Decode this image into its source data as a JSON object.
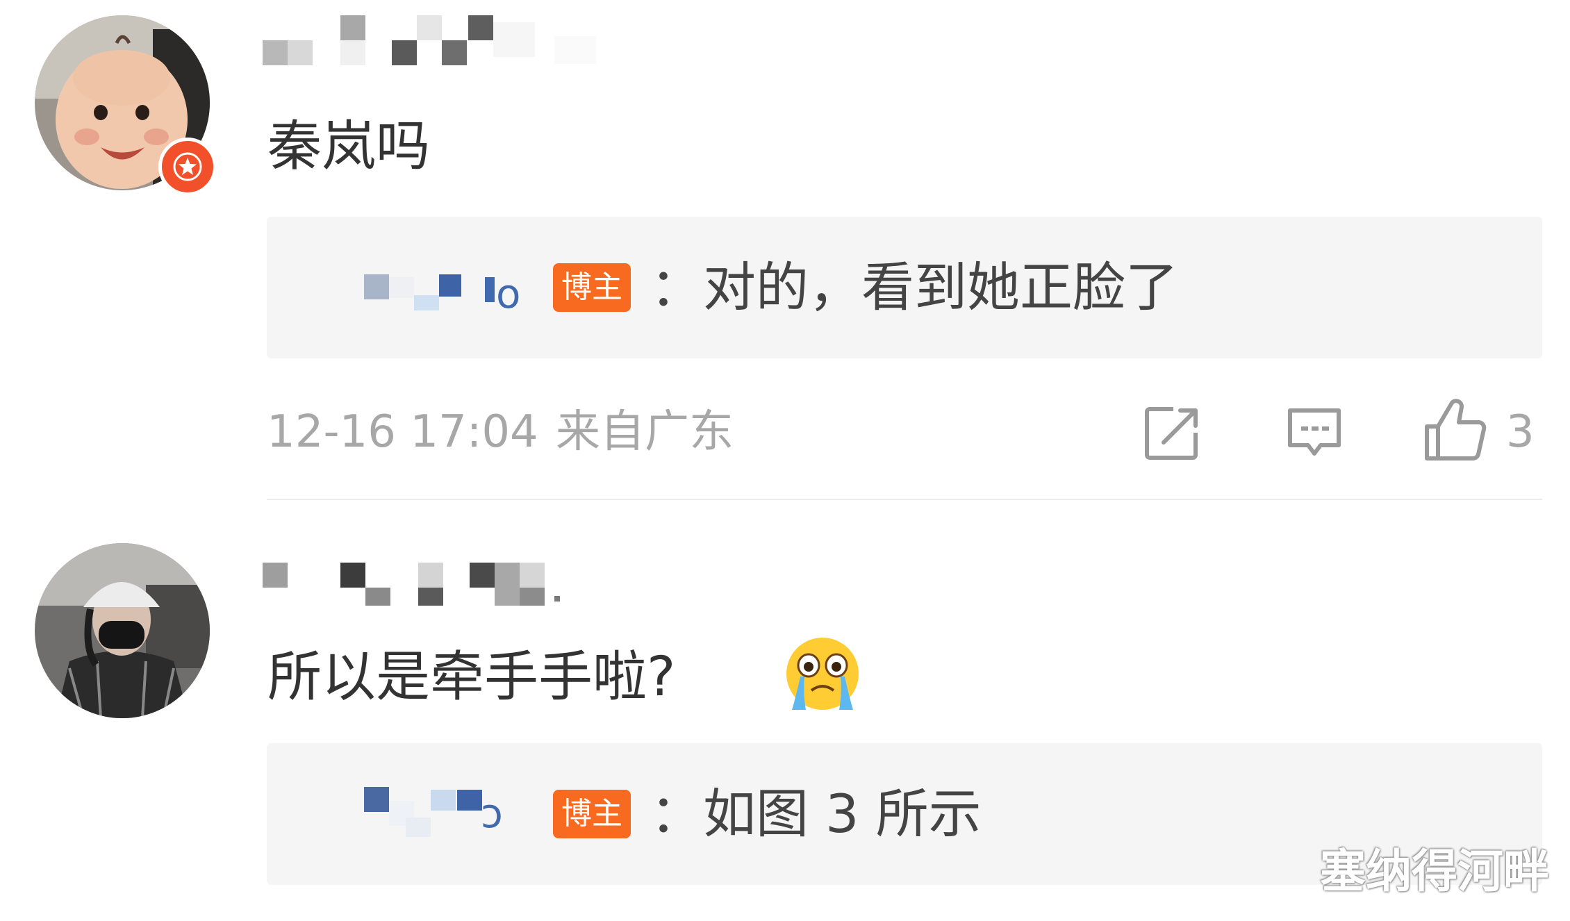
{
  "comments": [
    {
      "avatar_icon": "baby-photo-avatar",
      "badge_icon": "verified-star-badge",
      "text": "秦岚吗",
      "reply": {
        "badge": "博主",
        "text": "：对的，看到她正脸了"
      },
      "meta": {
        "timestamp": "12-16 17:04",
        "location": "来自广东"
      },
      "actions": {
        "share_icon": "share-icon",
        "comment_icon": "comment-icon",
        "like_icon": "thumbs-up-icon",
        "like_count": "3"
      }
    },
    {
      "avatar_icon": "masked-person-photo-avatar",
      "text": "所以是牵手手啦?",
      "emoji": "crying-face-emoji",
      "reply": {
        "badge": "博主",
        "text": "：如图 3 所示"
      }
    }
  ],
  "watermark": "塞纳得河畔",
  "colors": {
    "background": "#ffffff",
    "reply_background": "#f5f5f5",
    "blogger_badge": "#f86a1f",
    "verified_badge": "#f2502a",
    "meta_text": "#a7a7a7"
  }
}
